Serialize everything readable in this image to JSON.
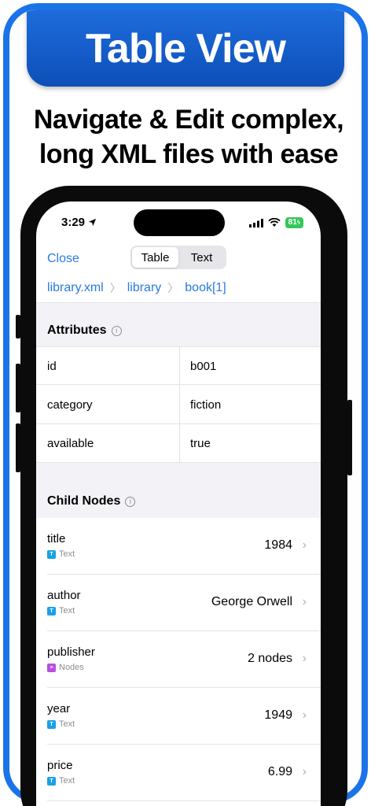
{
  "banner": {
    "title": "Table View"
  },
  "headline": {
    "line1": "Navigate & Edit complex,",
    "line2": "long XML files with ease"
  },
  "status_bar": {
    "time": "3:29",
    "battery": "81"
  },
  "navbar": {
    "close_label": "Close",
    "segments": [
      {
        "label": "Table",
        "active": true
      },
      {
        "label": "Text",
        "active": false
      }
    ]
  },
  "breadcrumb": {
    "items": [
      "library.xml",
      "library",
      "book[1]"
    ]
  },
  "attributes": {
    "header": "Attributes",
    "rows": [
      {
        "key": "id",
        "value": "b001"
      },
      {
        "key": "category",
        "value": "fiction"
      },
      {
        "key": "available",
        "value": "true"
      }
    ]
  },
  "child_nodes": {
    "header": "Child Nodes",
    "rows": [
      {
        "name": "title",
        "type": "Text",
        "badge": "T",
        "badge_color": "#1aa0e6",
        "value": "1984"
      },
      {
        "name": "author",
        "type": "Text",
        "badge": "T",
        "badge_color": "#1aa0e6",
        "value": "George Orwell"
      },
      {
        "name": "publisher",
        "type": "Nodes",
        "badge": "≡",
        "badge_color": "#b84fe0",
        "value": "2 nodes"
      },
      {
        "name": "year",
        "type": "Text",
        "badge": "T",
        "badge_color": "#1aa0e6",
        "value": "1949"
      },
      {
        "name": "price",
        "type": "Text",
        "badge": "T",
        "badge_color": "#1aa0e6",
        "value": "6.99"
      }
    ]
  },
  "colors": {
    "accent": "#2a7ae2",
    "frame": "#1a73e8",
    "battery": "#34c759"
  }
}
